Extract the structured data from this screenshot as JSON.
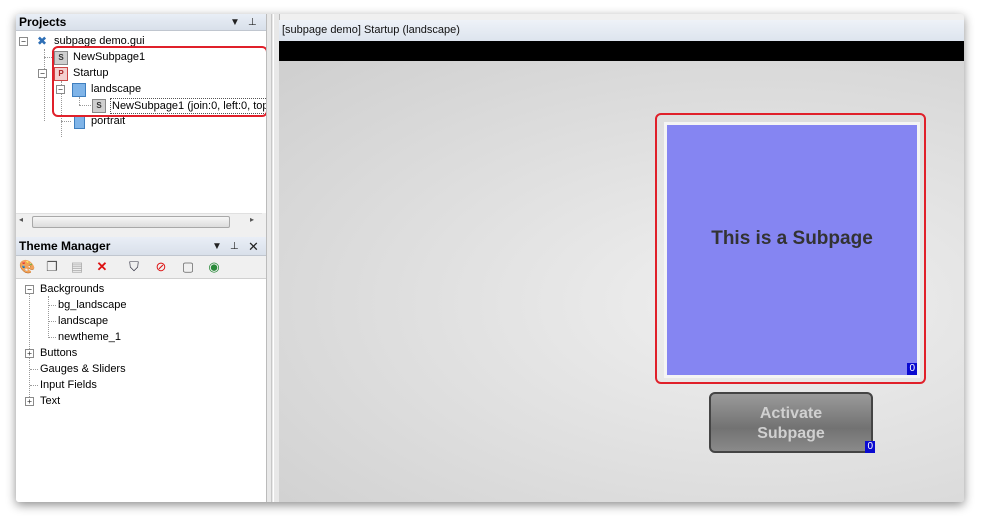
{
  "projects": {
    "title": "Projects",
    "tree": {
      "root": "subpage demo.gui",
      "newsubpage": "NewSubpage1",
      "startup": "Startup",
      "landscape": "landscape",
      "ref": "NewSubpage1 (join:0, left:0, top:",
      "portrait": "portrait"
    }
  },
  "theme": {
    "title": "Theme Manager",
    "items": {
      "backgrounds": "Backgrounds",
      "bg_landscape": "bg_landscape",
      "landscape": "landscape",
      "newtheme": "newtheme_1",
      "buttons": "Buttons",
      "gauges": "Gauges & Sliders",
      "inputs": "Input Fields",
      "text": "Text"
    }
  },
  "canvas": {
    "title": "[subpage demo] Startup (landscape)",
    "subpage_text": "This is a Subpage",
    "subpage_index": "0",
    "button_label_1": "Activate",
    "button_label_2": "Subpage",
    "button_index": "0"
  },
  "colors": {
    "subpage_fill": "#8585f2",
    "highlight": "#e0202a",
    "index_badge": "#0a0ad0"
  }
}
